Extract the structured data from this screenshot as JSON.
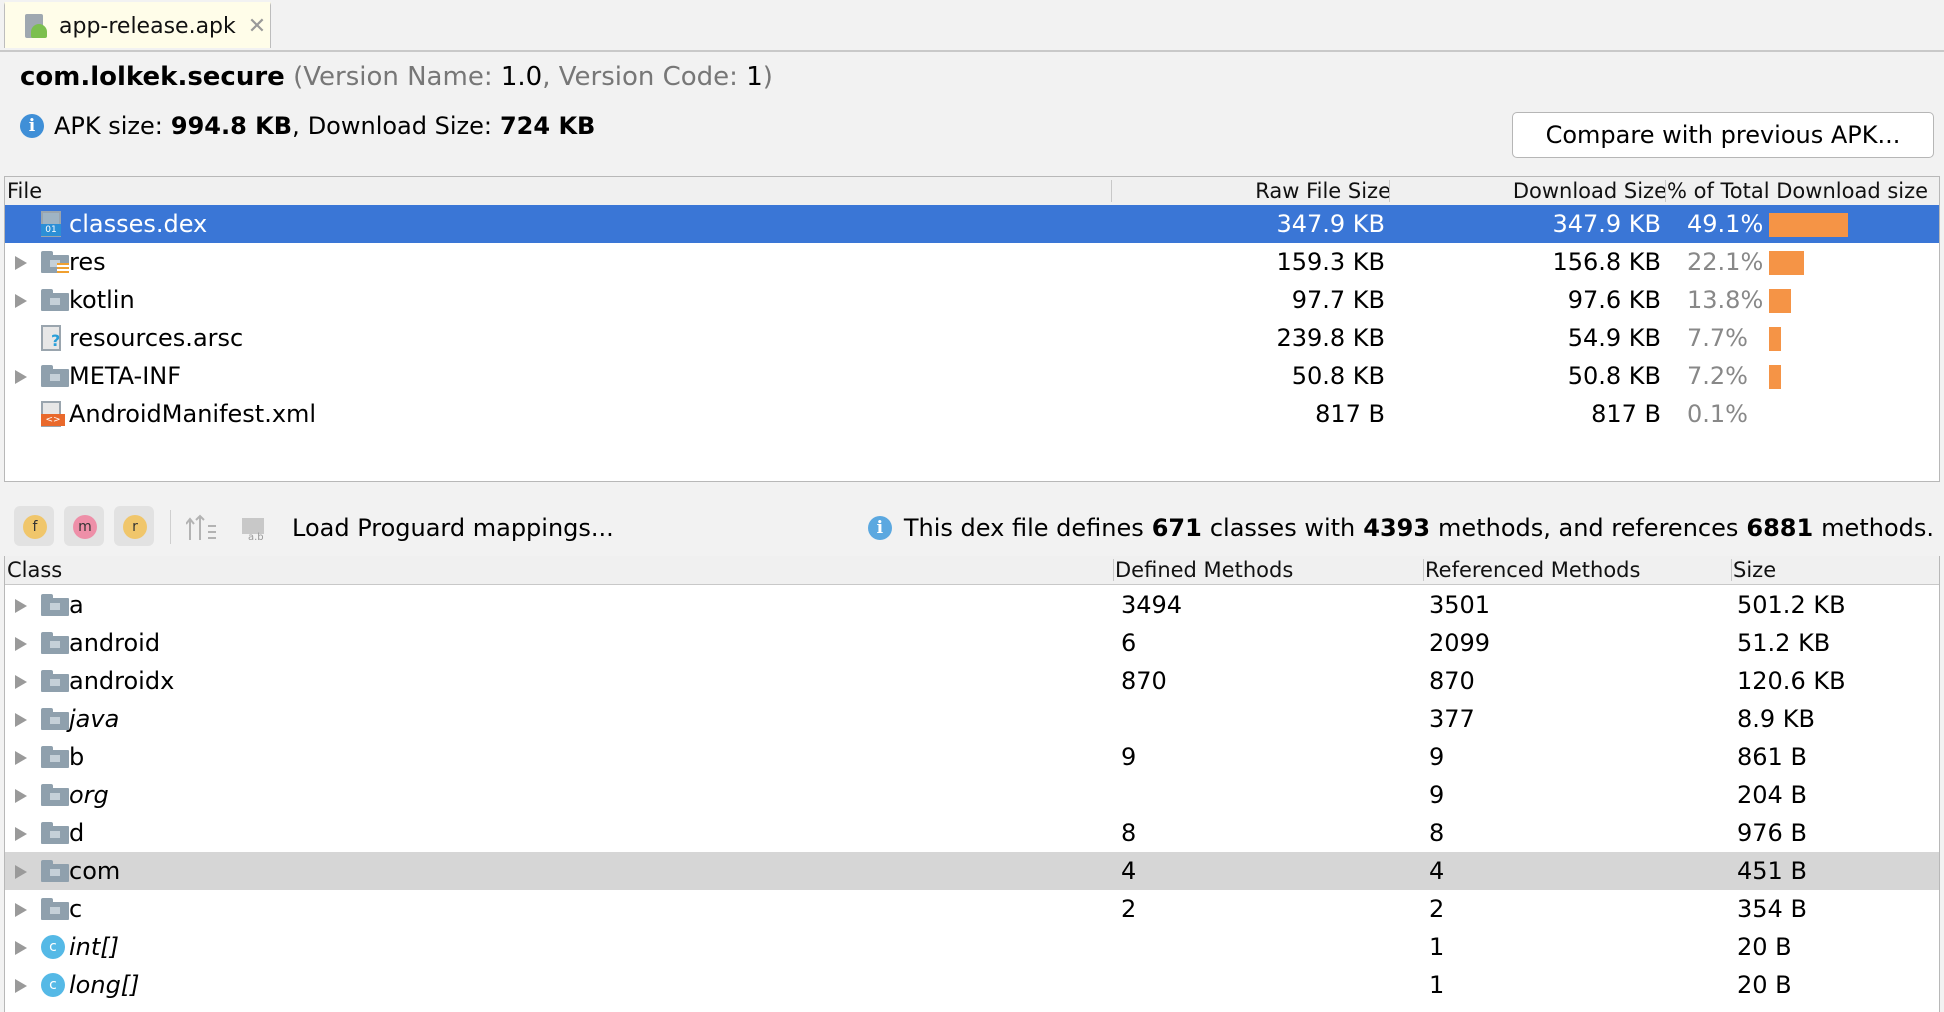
{
  "tab": {
    "label": "app-release.apk",
    "close": "✕"
  },
  "header": {
    "package": "com.lolkek.secure",
    "version_name_label": "Version Name:",
    "version_name": "1.0",
    "version_code_label": "Version Code:",
    "version_code": "1",
    "apk_size_label": "APK size:",
    "apk_size": "994.8 KB",
    "download_size_label": "Download Size:",
    "download_size": "724 KB",
    "compare_button": "Compare with previous APK..."
  },
  "files": {
    "columns": [
      "File",
      "Raw File Size",
      "Download Size",
      "% of Total Download size"
    ],
    "rows": [
      {
        "name": "classes.dex",
        "raw": "347.9 KB",
        "download": "347.9 KB",
        "pct": "49.1%",
        "share": 49.1,
        "icon": "dex-file-icon",
        "expandable": false,
        "selected": true
      },
      {
        "name": "res",
        "raw": "159.3 KB",
        "download": "156.8 KB",
        "pct": "22.1%",
        "share": 22.1,
        "icon": "res-folder-icon",
        "expandable": true,
        "selected": false
      },
      {
        "name": "kotlin",
        "raw": "97.7 KB",
        "download": "97.6 KB",
        "pct": "13.8%",
        "share": 13.8,
        "icon": "folder-icon",
        "expandable": true,
        "selected": false
      },
      {
        "name": "resources.arsc",
        "raw": "239.8 KB",
        "download": "54.9 KB",
        "pct": "7.7%",
        "share": 7.7,
        "icon": "unknown-file-icon",
        "expandable": false,
        "selected": false
      },
      {
        "name": "META-INF",
        "raw": "50.8 KB",
        "download": "50.8 KB",
        "pct": "7.2%",
        "share": 7.2,
        "icon": "folder-icon",
        "expandable": true,
        "selected": false
      },
      {
        "name": "AndroidManifest.xml",
        "raw": "817 B",
        "download": "817 B",
        "pct": "0.1%",
        "share": 0.1,
        "icon": "xml-file-icon",
        "expandable": false,
        "selected": false
      }
    ]
  },
  "toolbar": {
    "filter_f": "f",
    "filter_m": "m",
    "filter_r": "r",
    "load_mappings": "Load Proguard mappings...",
    "info_prefix": "This dex file defines",
    "classes_count": "671",
    "classes_word": "classes with",
    "methods_count": "4393",
    "methods_word": "methods, and references",
    "ref_count": "6881",
    "ref_word": "methods."
  },
  "classes": {
    "columns": [
      "Class",
      "Defined Methods",
      "Referenced Methods",
      "Size"
    ],
    "rows": [
      {
        "name": "a",
        "defined": "3494",
        "referenced": "3501",
        "size": "501.2 KB",
        "italic": false,
        "icon": "package-icon",
        "highlight": false
      },
      {
        "name": "android",
        "defined": "6",
        "referenced": "2099",
        "size": "51.2 KB",
        "italic": false,
        "icon": "package-icon",
        "highlight": false
      },
      {
        "name": "androidx",
        "defined": "870",
        "referenced": "870",
        "size": "120.6 KB",
        "italic": false,
        "icon": "package-icon",
        "highlight": false
      },
      {
        "name": "java",
        "defined": "",
        "referenced": "377",
        "size": "8.9 KB",
        "italic": true,
        "icon": "package-icon",
        "highlight": false
      },
      {
        "name": "b",
        "defined": "9",
        "referenced": "9",
        "size": "861 B",
        "italic": false,
        "icon": "package-icon",
        "highlight": false
      },
      {
        "name": "org",
        "defined": "",
        "referenced": "9",
        "size": "204 B",
        "italic": true,
        "icon": "package-icon",
        "highlight": false
      },
      {
        "name": "d",
        "defined": "8",
        "referenced": "8",
        "size": "976 B",
        "italic": false,
        "icon": "package-icon",
        "highlight": false
      },
      {
        "name": "com",
        "defined": "4",
        "referenced": "4",
        "size": "451 B",
        "italic": false,
        "icon": "package-icon",
        "highlight": true
      },
      {
        "name": "c",
        "defined": "2",
        "referenced": "2",
        "size": "354 B",
        "italic": false,
        "icon": "package-icon",
        "highlight": false
      },
      {
        "name": "int[]",
        "defined": "",
        "referenced": "1",
        "size": "20 B",
        "italic": true,
        "icon": "class-icon",
        "highlight": false
      },
      {
        "name": "long[]",
        "defined": "",
        "referenced": "1",
        "size": "20 B",
        "italic": true,
        "icon": "class-icon",
        "highlight": false
      }
    ]
  },
  "colors": {
    "selection": "#3a76d6",
    "bar": "#f59446",
    "info": "#3f8fd7"
  }
}
